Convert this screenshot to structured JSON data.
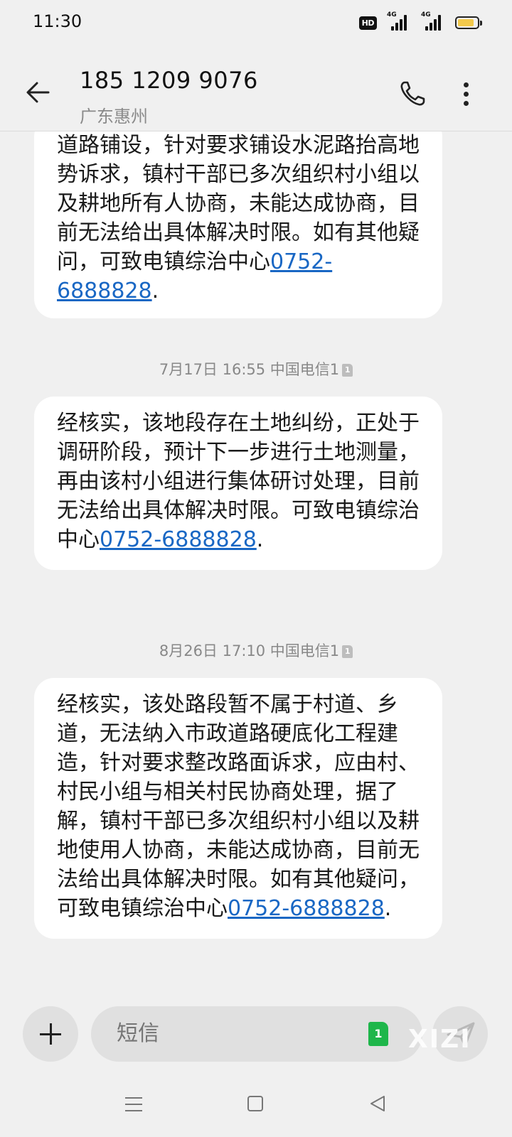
{
  "status_bar": {
    "time": "11:30",
    "hd_label": "HD",
    "signal1_label": "4G",
    "signal2_label": "4G",
    "battery_level": 0.85,
    "battery_color": "#f2c94c"
  },
  "header": {
    "back_icon": "arrow-left-icon",
    "contact_number": "185 1209 9076",
    "contact_location": "广东惠州",
    "call_icon": "phone-icon",
    "menu_icon": "more-vertical-icon"
  },
  "messages": [
    {
      "text_before_link": "道路铺设，针对要求铺设水泥路抬高地势诉求，镇村干部已多次组织村小组以及耕地所有人协商，未能达成协商，目前无法给出具体解决时限。如有其他疑问，可致电镇综治中心",
      "link": "0752-6888828",
      "text_after_link": "."
    },
    {
      "timestamp": "7月17日 16:55 中国电信1",
      "text_before_link": "经核实，该地段存在土地纠纷，正处于调研阶段，预计下一步进行土地测量，再由该村小组进行集体研讨处理，目前无法给出具体解决时限。可致电镇综治中心",
      "link": "0752-6888828",
      "text_after_link": "."
    },
    {
      "timestamp": "8月26日 17:10 中国电信1",
      "text_before_link": "经核实，该处路段暂不属于村道、乡道，无法纳入市政道路硬底化工程建造，针对要求整改路面诉求，应由村、村民小组与相关村民协商处理，据了解，镇村干部已多次组织村小组以及耕地使用人协商，未能达成协商，目前无法给出具体解决时限。如有其他疑问，可致电镇综治中心",
      "link": "0752-6888828",
      "text_after_link": "."
    }
  ],
  "composer": {
    "placeholder": "短信",
    "sim_label": "1",
    "watermark": "XIZI",
    "add_icon": "plus-icon",
    "send_icon": "send-icon"
  },
  "colors": {
    "link": "#1967c4",
    "background": "#f0f0f0",
    "bubble": "#ffffff",
    "sim_green": "#1fb64b"
  }
}
